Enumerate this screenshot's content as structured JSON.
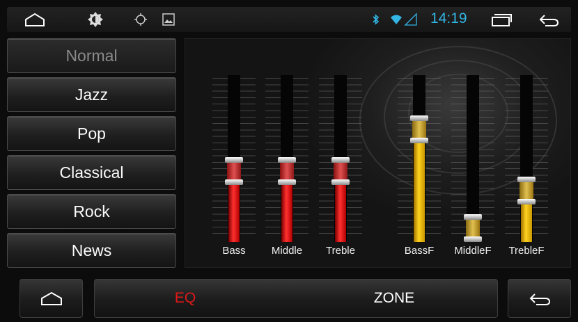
{
  "statusbar": {
    "time": "14:19",
    "icons": [
      "home-outline-icon",
      "brightness-icon",
      "gps-icon",
      "picture-icon",
      "bluetooth-icon",
      "wifi-signal-icon",
      "recent-apps-icon",
      "back-icon"
    ]
  },
  "presets": [
    {
      "label": "Normal",
      "selected": true
    },
    {
      "label": "Jazz",
      "selected": false
    },
    {
      "label": "Pop",
      "selected": false
    },
    {
      "label": "Classical",
      "selected": false
    },
    {
      "label": "Rock",
      "selected": false
    },
    {
      "label": "News",
      "selected": false
    }
  ],
  "eq": {
    "sliders": [
      {
        "label": "Bass",
        "level": 0.41,
        "color": "#e02020"
      },
      {
        "label": "Middle",
        "level": 0.41,
        "color": "#e02020"
      },
      {
        "label": "Treble",
        "level": 0.41,
        "color": "#e02020"
      },
      {
        "label": "BassF",
        "level": 0.71,
        "color": "#f2c21a"
      },
      {
        "label": "MiddleF",
        "level": 0.0,
        "color": "#f2c21a"
      },
      {
        "label": "TrebleF",
        "level": 0.27,
        "color": "#f2c21a"
      }
    ]
  },
  "bottom": {
    "tabs": [
      {
        "label": "EQ",
        "active": true,
        "color": "#e01818"
      },
      {
        "label": "ZONE",
        "active": false,
        "color": "#ffffff"
      }
    ]
  }
}
